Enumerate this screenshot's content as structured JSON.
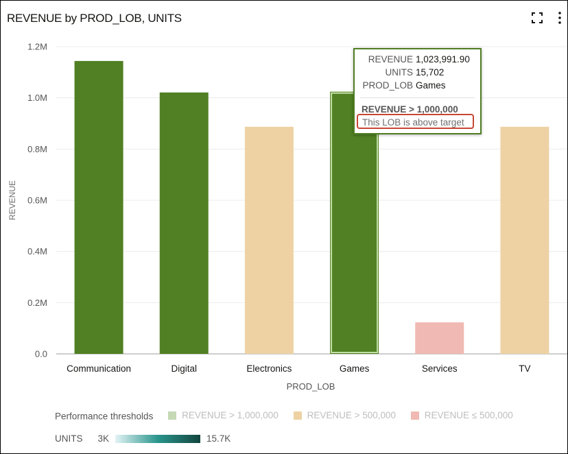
{
  "header": {
    "title": "REVENUE by PROD_LOB, UNITS",
    "expand_icon": "expand-icon",
    "menu_icon": "kebab-menu-icon"
  },
  "tooltip": {
    "rows": [
      {
        "key": "REVENUE",
        "value": "1,023,991.90"
      },
      {
        "key": "UNITS",
        "value": "15,702"
      },
      {
        "key": "PROD_LOB",
        "value": "Games"
      }
    ],
    "threshold": "REVENUE > 1,000,000",
    "message": "This LOB is above target"
  },
  "legend": {
    "thresholds_label": "Performance thresholds",
    "items": [
      {
        "label": "REVENUE > 1,000,000",
        "color": "#c5d9b5"
      },
      {
        "label": "REVENUE > 500,000",
        "color": "#eed2a4"
      },
      {
        "label": "REVENUE ≤ 500,000",
        "color": "#f0b9b3"
      }
    ],
    "units_label": "UNITS",
    "units_min": "3K",
    "units_max": "15.7K"
  },
  "chart_data": {
    "type": "bar",
    "title": "REVENUE by PROD_LOB, UNITS",
    "xlabel": "PROD_LOB",
    "ylabel": "REVENUE",
    "categories": [
      "Communication",
      "Digital",
      "Electronics",
      "Games",
      "Services",
      "TV"
    ],
    "values": [
      1144000,
      1021000,
      887000,
      1023991.9,
      123000,
      887000
    ],
    "colors": [
      "#508023",
      "#508023",
      "#eed2a4",
      "#508023",
      "#f0b9b3",
      "#eed2a4"
    ],
    "highlighted": "Games",
    "ylim": [
      0,
      1200000
    ],
    "yticks": [
      0,
      200000,
      400000,
      600000,
      800000,
      1000000,
      1200000
    ],
    "ytick_labels": [
      "0.0",
      "0.2M",
      "0.4M",
      "0.6M",
      "0.8M",
      "1.0M",
      "1.2M"
    ],
    "grid": true,
    "legend_position": "bottom"
  }
}
